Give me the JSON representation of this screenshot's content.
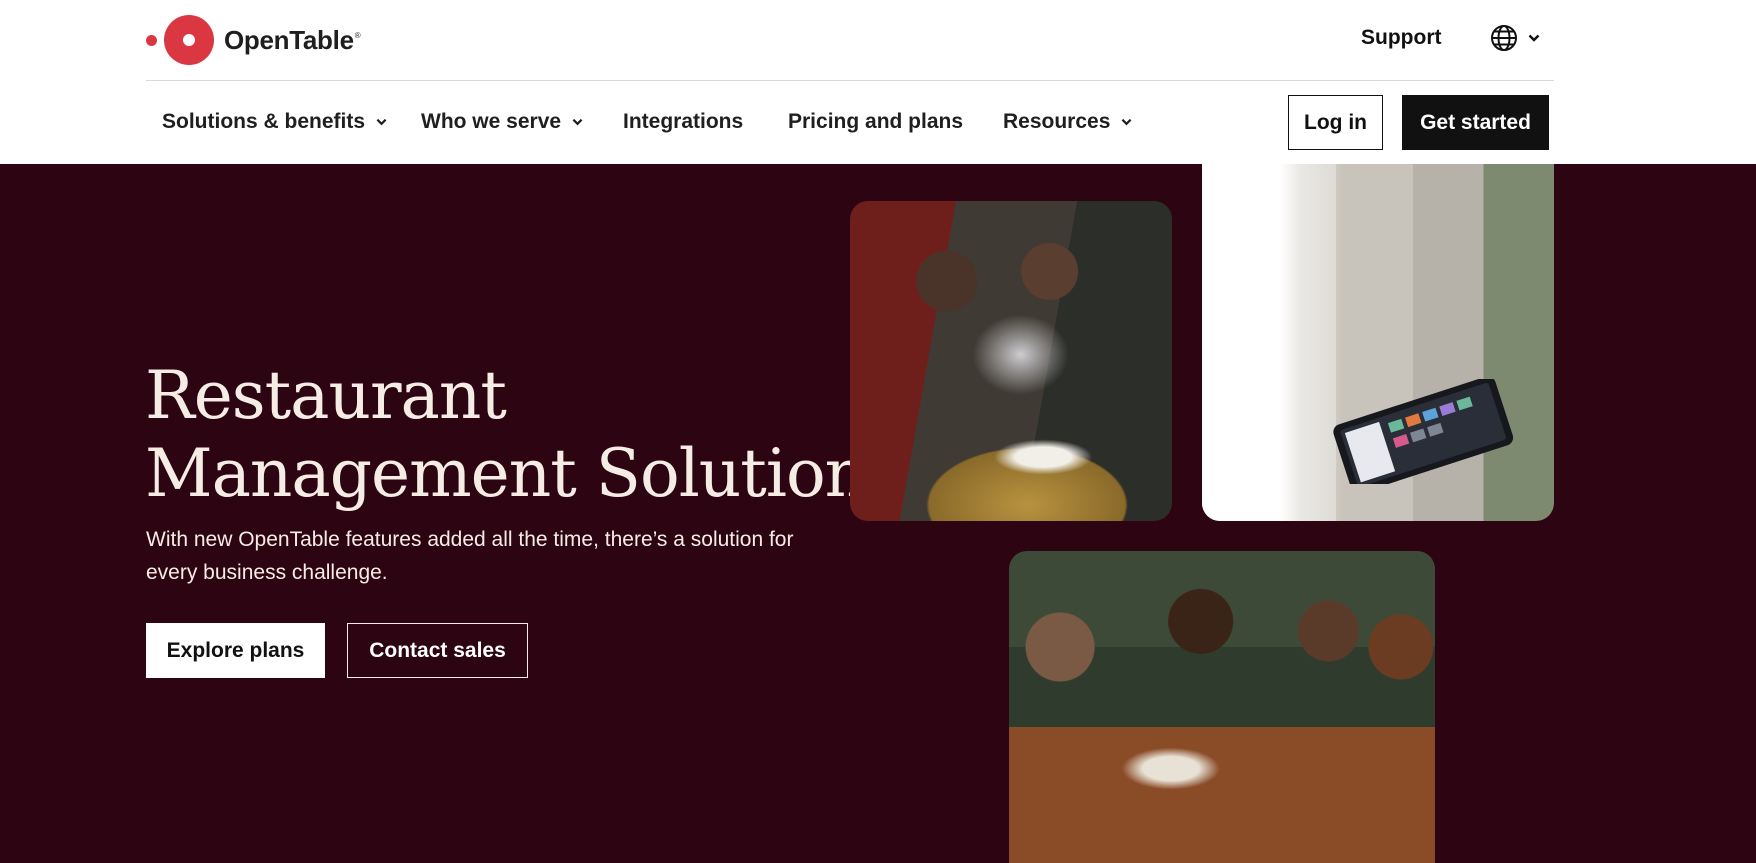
{
  "brand": {
    "name": "OpenTable",
    "registered_mark": "®",
    "color": "#da3743"
  },
  "topbar": {
    "support_label": "Support",
    "language_icon": "globe-icon",
    "language_chevron": "chevron-down-icon"
  },
  "nav": {
    "items": [
      {
        "label": "Solutions & benefits",
        "has_dropdown": true
      },
      {
        "label": "Who we serve",
        "has_dropdown": true
      },
      {
        "label": "Integrations",
        "has_dropdown": false
      },
      {
        "label": "Pricing and plans",
        "has_dropdown": false
      },
      {
        "label": "Resources",
        "has_dropdown": true
      }
    ],
    "login_label": "Log in",
    "get_started_label": "Get started"
  },
  "hero": {
    "title_line1": "Restaurant",
    "title_line2": "Management Solutions",
    "subtitle": "With new OpenTable features added all the time, there’s a solution for every business challenge.",
    "primary_cta": "Explore plans",
    "secondary_cta": "Contact sales",
    "background_color": "#2d0512",
    "text_color": "#f6ece6"
  }
}
